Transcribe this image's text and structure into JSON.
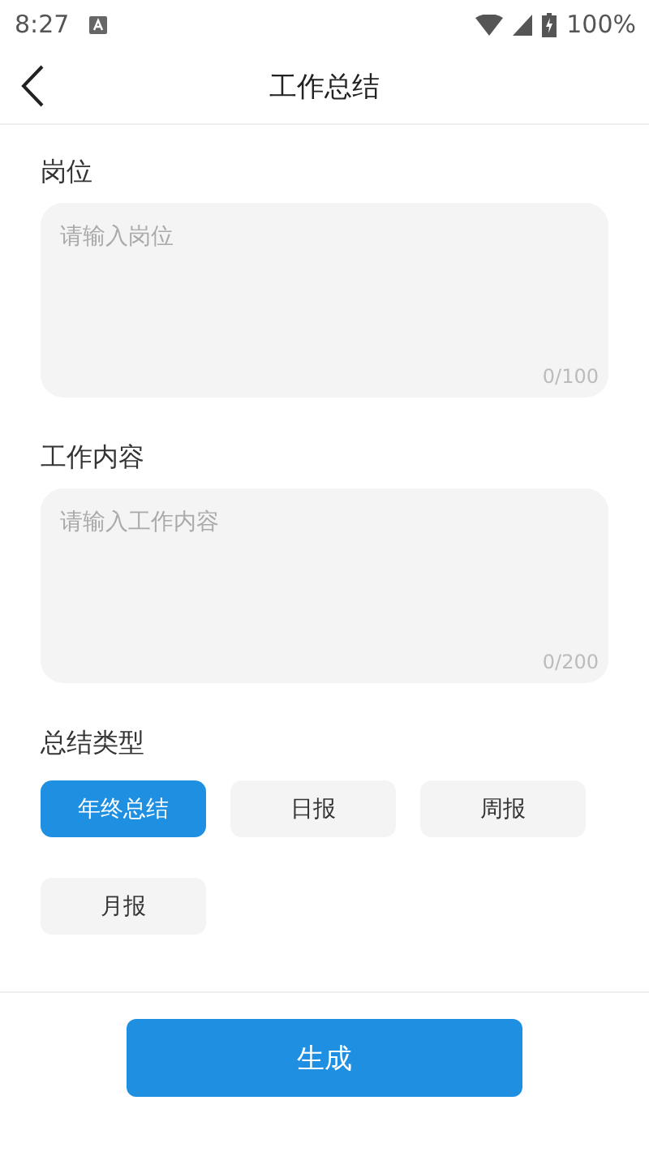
{
  "status_bar": {
    "time": "8:27",
    "battery": "100%"
  },
  "header": {
    "title": "工作总结"
  },
  "fields": [
    {
      "label": "岗位",
      "placeholder": "请输入岗位",
      "counter": "0/100"
    },
    {
      "label": "工作内容",
      "placeholder": "请输入工作内容",
      "counter": "0/200"
    }
  ],
  "summary_type": {
    "label": "总结类型",
    "options": [
      {
        "label": "年终总结",
        "selected": true
      },
      {
        "label": "日报",
        "selected": false
      },
      {
        "label": "周报",
        "selected": false
      },
      {
        "label": "月报",
        "selected": false
      }
    ]
  },
  "generate_button": "生成"
}
